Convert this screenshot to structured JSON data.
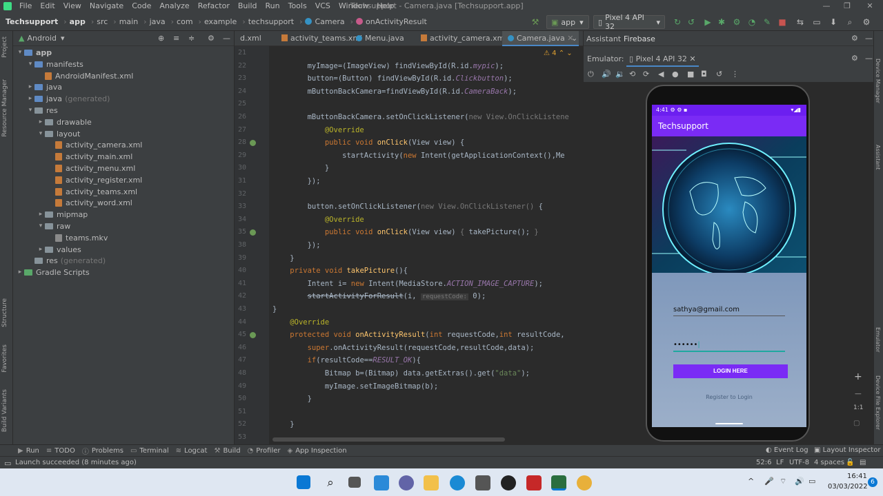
{
  "menu": [
    "File",
    "Edit",
    "View",
    "Navigate",
    "Code",
    "Analyze",
    "Refactor",
    "Build",
    "Run",
    "Tools",
    "VCS",
    "Window",
    "Help"
  ],
  "window_title": "Techsupport - Camera.java [Techsupport.app]",
  "breadcrumb": [
    "Techsupport",
    "app",
    "src",
    "main",
    "java",
    "com",
    "example",
    "techsupport",
    "Camera",
    "onActivityResult"
  ],
  "toolbar": {
    "config": "app",
    "device": "Pixel 4 API 32"
  },
  "project_view": "Android",
  "tree": [
    {
      "label": "app",
      "indent": 0,
      "kind": "folder-blue",
      "arrow": "v"
    },
    {
      "label": "manifests",
      "indent": 1,
      "kind": "folder-blue",
      "arrow": "v"
    },
    {
      "label": "AndroidManifest.xml",
      "indent": 2,
      "kind": "xml",
      "arrow": ""
    },
    {
      "label": "java",
      "indent": 1,
      "kind": "folder-blue",
      "arrow": ">"
    },
    {
      "label": "java",
      "suffix": "(generated)",
      "indent": 1,
      "kind": "folder-blue",
      "arrow": ">"
    },
    {
      "label": "res",
      "indent": 1,
      "kind": "folder",
      "arrow": "v"
    },
    {
      "label": "drawable",
      "indent": 2,
      "kind": "folder",
      "arrow": ">"
    },
    {
      "label": "layout",
      "indent": 2,
      "kind": "folder",
      "arrow": "v"
    },
    {
      "label": "activity_camera.xml",
      "indent": 3,
      "kind": "xml",
      "arrow": ""
    },
    {
      "label": "activity_main.xml",
      "indent": 3,
      "kind": "xml",
      "arrow": ""
    },
    {
      "label": "activity_menu.xml",
      "indent": 3,
      "kind": "xml",
      "arrow": ""
    },
    {
      "label": "activity_register.xml",
      "indent": 3,
      "kind": "xml",
      "arrow": ""
    },
    {
      "label": "activity_teams.xml",
      "indent": 3,
      "kind": "xml",
      "arrow": ""
    },
    {
      "label": "activity_word.xml",
      "indent": 3,
      "kind": "xml",
      "arrow": ""
    },
    {
      "label": "mipmap",
      "indent": 2,
      "kind": "folder",
      "arrow": ">"
    },
    {
      "label": "raw",
      "indent": 2,
      "kind": "folder",
      "arrow": "v"
    },
    {
      "label": "teams.mkv",
      "indent": 3,
      "kind": "file",
      "arrow": ""
    },
    {
      "label": "values",
      "indent": 2,
      "kind": "folder",
      "arrow": ">"
    },
    {
      "label": "res",
      "suffix": "(generated)",
      "indent": 1,
      "kind": "folder",
      "arrow": ""
    },
    {
      "label": "Gradle Scripts",
      "indent": 0,
      "kind": "gradle",
      "arrow": ">"
    }
  ],
  "editor_tabs": [
    {
      "label": "d.xml",
      "kind": "xml"
    },
    {
      "label": "activity_teams.xml",
      "kind": "xml"
    },
    {
      "label": "Menu.java",
      "kind": "java"
    },
    {
      "label": "activity_camera.xml",
      "kind": "xml"
    },
    {
      "label": "Camera.java",
      "kind": "java",
      "active": true
    }
  ],
  "warnings": "4",
  "code_lines": [
    {
      "n": "21",
      "html": ""
    },
    {
      "n": "22",
      "html": "        myImage=(ImageView) findViewById(R.id.<span class='it'>mypic</span>);"
    },
    {
      "n": "23",
      "html": "        button=(Button) findViewById(R.id.<span class='it'>Clickbutton</span>);"
    },
    {
      "n": "24",
      "html": "        mButtonBackCamera=findViewById(R.id.<span class='it'>CameraBack</span>);"
    },
    {
      "n": "25",
      "html": ""
    },
    {
      "n": "26",
      "html": "        mButtonBackCamera.setOnClickListener(<span class='gr'>new View.OnClickListene</span>"
    },
    {
      "n": "27",
      "html": "            <span class='an'>@Override</span>"
    },
    {
      "n": "28",
      "html": "            <span class='kw'>public void</span> <span class='fn'>onClick</span>(View view) {"
    },
    {
      "n": "29",
      "html": "                startActivity(<span class='kw'>new</span> Intent(getApplicationContext(),Me"
    },
    {
      "n": "30",
      "html": "            }"
    },
    {
      "n": "31",
      "html": "        });"
    },
    {
      "n": "32",
      "html": ""
    },
    {
      "n": "33",
      "html": "        button.setOnClickListener(<span class='gr'>new View.OnClickListener()</span> {"
    },
    {
      "n": "34",
      "html": "            <span class='an'>@Override</span>"
    },
    {
      "n": "35",
      "html": "            <span class='kw'>public void</span> <span class='fn'>onClick</span>(View view) <span class='gr'>{</span> takePicture(); <span class='gr'>}</span>"
    },
    {
      "n": "38",
      "html": "        });"
    },
    {
      "n": "39",
      "html": "    }"
    },
    {
      "n": "40",
      "html": "    <span class='kw'>private void</span> <span class='fn'>takePicture</span>(){"
    },
    {
      "n": "41",
      "html": "        Intent i= <span class='kw'>new</span> Intent(MediaStore.<span class='it'>ACTION_IMAGE_CAPTURE</span>);"
    },
    {
      "n": "42",
      "html": "        <span class='strike'>startActivityForResult</span>(i, <span class='hint'>requestCode:</span> 0);"
    },
    {
      "n": "43",
      "html": "}"
    },
    {
      "n": "44",
      "html": "    <span class='an'>@Override</span>"
    },
    {
      "n": "45",
      "html": "    <span class='kw'>protected void</span> <span class='fn'>onActivityResult</span>(<span class='kw'>int</span> requestCode,<span class='kw'>int</span> resultCode,"
    },
    {
      "n": "46",
      "html": "        <span class='kw'>super</span>.onActivityResult(requestCode,resultCode,data);"
    },
    {
      "n": "47",
      "html": "        <span class='kw'>if</span>(resultCode==<span class='it'>RESULT_OK</span>){"
    },
    {
      "n": "48",
      "html": "            Bitmap b=(Bitmap) data.getExtras().get(<span class='st'>\"data\"</span>);"
    },
    {
      "n": "49",
      "html": "            myImage.setImageBitmap(b);"
    },
    {
      "n": "50",
      "html": "        }"
    },
    {
      "n": "51",
      "html": ""
    },
    {
      "n": "52",
      "html": "    }"
    },
    {
      "n": "53",
      "html": ""
    }
  ],
  "right_tabs": [
    "Assistant",
    "Firebase"
  ],
  "emulator": {
    "label": "Emulator:",
    "device": "Pixel 4 API 32"
  },
  "phone": {
    "time": "4:41",
    "app_title": "Techsupport",
    "email": "sathya@gmail.com",
    "password": "••••••",
    "login_btn": "LOGIN HERE",
    "register": "Register to Login"
  },
  "bottom_tools": [
    "Run",
    "TODO",
    "Problems",
    "Terminal",
    "Logcat",
    "Build",
    "Profiler",
    "App Inspection"
  ],
  "bottom_right": [
    "Event Log",
    "Layout Inspector"
  ],
  "status": {
    "message": "Launch succeeded (8 minutes ago)",
    "pos": "52:6",
    "lf": "LF",
    "enc": "UTF-8",
    "indent": "4 spaces"
  },
  "clock": {
    "time": "16:41",
    "date": "03/03/2022",
    "badge": "6"
  },
  "left_strip": [
    "Project",
    "Resource Manager",
    "Structure",
    "Favorites",
    "Build Variants"
  ],
  "right_strip": [
    "Device Manager",
    "Assistant",
    "Emulator",
    "Device File Explorer"
  ],
  "zoom": {
    "one_to_one": "1:1"
  }
}
